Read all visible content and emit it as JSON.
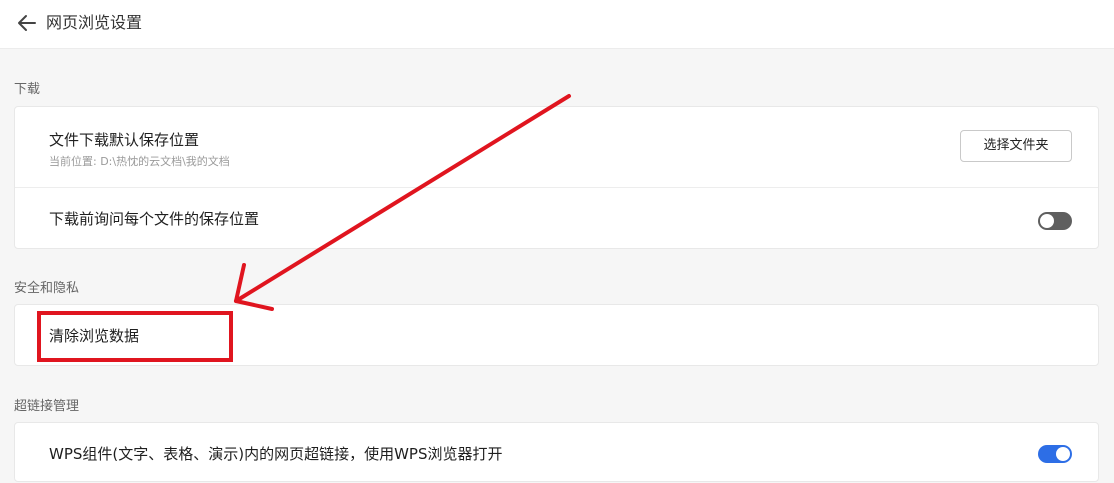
{
  "header": {
    "title": "网页浏览设置"
  },
  "sections": {
    "download": {
      "title": "下载",
      "default_location": {
        "title": "文件下载默认保存位置",
        "subtitle": "当前位置: D:\\热忱的云文档\\我的文档",
        "button_label": "选择文件夹"
      },
      "ask_location": {
        "title": "下载前询问每个文件的保存位置",
        "toggle_state": "off"
      }
    },
    "security": {
      "title": "安全和隐私",
      "clear_data": {
        "title": "清除浏览数据"
      }
    },
    "hyperlink": {
      "title": "超链接管理",
      "wps_open": {
        "title": "WPS组件(文字、表格、演示)内的网页超链接，使用WPS浏览器打开",
        "toggle_state": "on"
      }
    }
  },
  "colors": {
    "annotation": "#e0151f",
    "toggle_on": "#2d6ee6",
    "toggle_off": "#5f5f5f"
  }
}
